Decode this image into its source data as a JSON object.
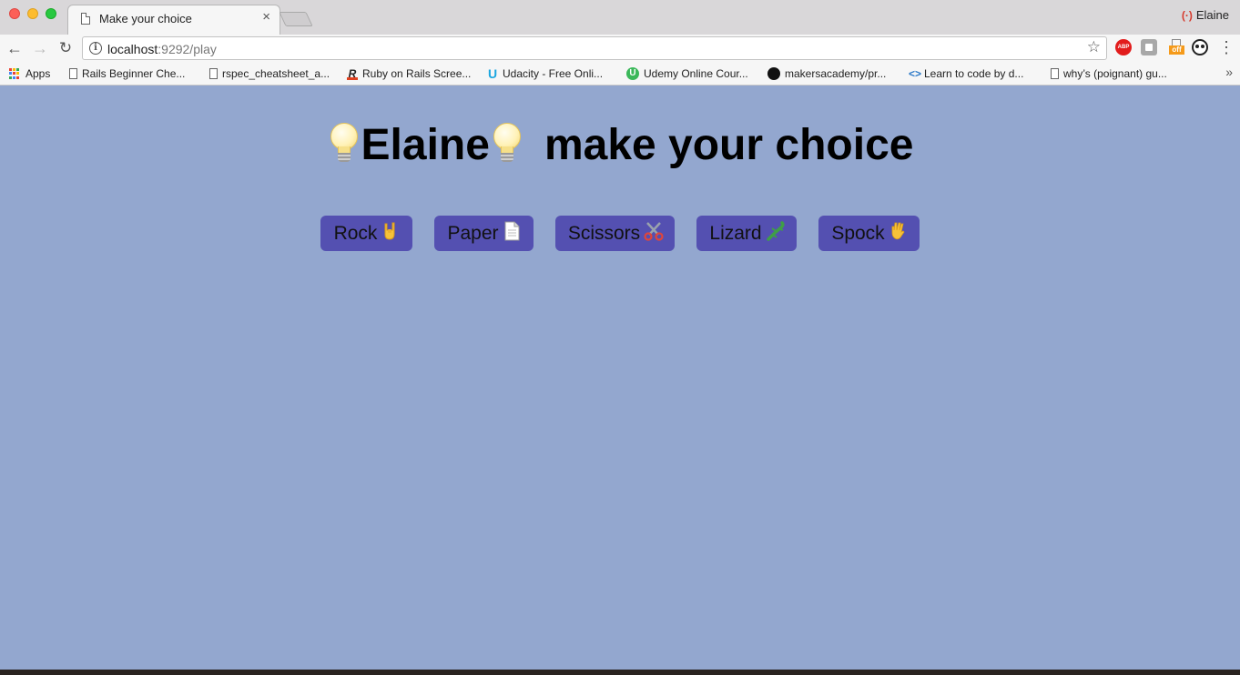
{
  "browser": {
    "tab_title": "Make your choice",
    "tab_close": "×",
    "profile_name": "Elaine",
    "url_host": "localhost",
    "url_path": ":9292/play",
    "abp_label": "ABP",
    "off_label": "off",
    "more_bookmarks": "»"
  },
  "bookmarks": [
    {
      "label": "Apps",
      "icon": "apps-grid-icon"
    },
    {
      "label": "Rails Beginner Che...",
      "icon": "page-icon"
    },
    {
      "label": "rspec_cheatsheet_a...",
      "icon": "page-icon"
    },
    {
      "label": "Ruby on Rails Scree...",
      "icon": "railscasts-icon"
    },
    {
      "label": "Udacity - Free Onli...",
      "icon": "udacity-icon"
    },
    {
      "label": "Udemy Online Cour...",
      "icon": "udemy-icon"
    },
    {
      "label": "makersacademy/pr...",
      "icon": "github-icon"
    },
    {
      "label": "Learn to code by d...",
      "icon": "code-icon"
    },
    {
      "label": "why’s (poignant) gu...",
      "icon": "page-icon"
    }
  ],
  "page": {
    "player_name": "Elaine",
    "headline_rest": "make your choice",
    "background_color": "#93a7cf",
    "button_color": "#5450b1",
    "choices": [
      {
        "label": "Rock",
        "icon": "rock-on-hand-icon"
      },
      {
        "label": "Paper",
        "icon": "page-icon"
      },
      {
        "label": "Scissors",
        "icon": "scissors-icon"
      },
      {
        "label": "Lizard",
        "icon": "lizard-icon"
      },
      {
        "label": "Spock",
        "icon": "vulcan-salute-icon"
      }
    ]
  }
}
